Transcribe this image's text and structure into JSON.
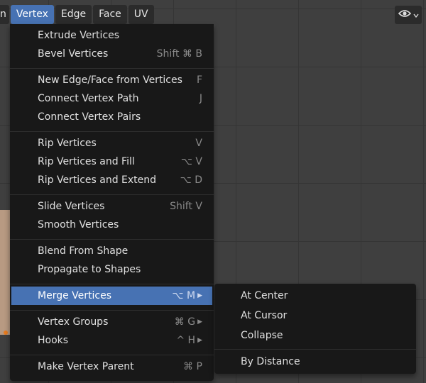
{
  "header": {
    "cut_item": "n",
    "items": [
      "Vertex",
      "Edge",
      "Face",
      "UV"
    ]
  },
  "overlay": {
    "icon": "eye-icon",
    "dropdown_icon": "chevron-down-icon"
  },
  "menu": {
    "items": [
      {
        "label": "Extrude Vertices",
        "shortcut": ""
      },
      {
        "label": "Bevel Vertices",
        "shortcut": "Shift ⌘ B"
      },
      {
        "label": "New Edge/Face from Vertices",
        "shortcut": "F"
      },
      {
        "label": "Connect Vertex Path",
        "shortcut": "J"
      },
      {
        "label": "Connect Vertex Pairs",
        "shortcut": ""
      },
      {
        "label": "Rip Vertices",
        "shortcut": "V"
      },
      {
        "label": "Rip Vertices and Fill",
        "shortcut": "⌥ V"
      },
      {
        "label": "Rip Vertices and Extend",
        "shortcut": "⌥ D"
      },
      {
        "label": "Slide Vertices",
        "shortcut": "Shift V"
      },
      {
        "label": "Smooth Vertices",
        "shortcut": ""
      },
      {
        "label": "Blend From Shape",
        "shortcut": ""
      },
      {
        "label": "Propagate to Shapes",
        "shortcut": ""
      },
      {
        "label": "Merge Vertices",
        "shortcut": "⌥ M"
      },
      {
        "label": "Vertex Groups",
        "shortcut": "⌘ G"
      },
      {
        "label": "Hooks",
        "shortcut": "^ H"
      },
      {
        "label": "Make Vertex Parent",
        "shortcut": "⌘ P"
      }
    ]
  },
  "submenu": {
    "items": [
      "At Center",
      "At Cursor",
      "Collapse",
      "By Distance"
    ]
  },
  "colors": {
    "highlight": "#4772b3",
    "menu_bg": "#181818"
  }
}
